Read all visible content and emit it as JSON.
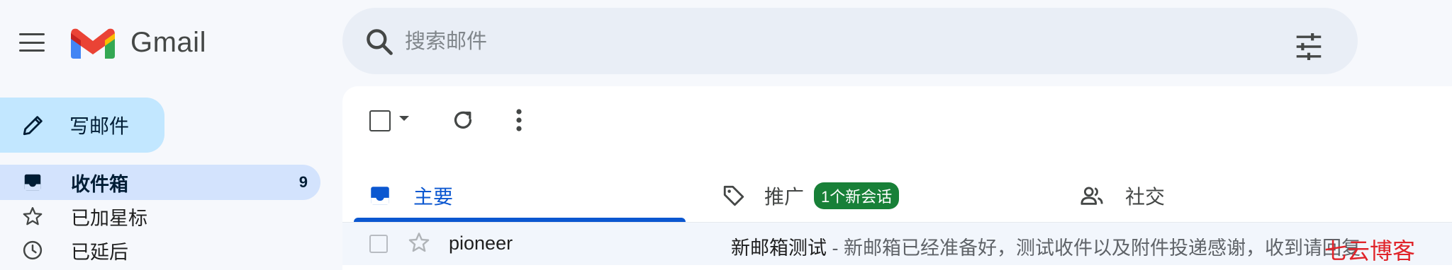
{
  "app": {
    "name": "Gmail"
  },
  "search": {
    "placeholder": "搜索邮件"
  },
  "compose": {
    "label": "写邮件"
  },
  "sidebar": {
    "items": [
      {
        "label": "收件箱",
        "count": "9"
      },
      {
        "label": "已加星标"
      },
      {
        "label": "已延后"
      }
    ]
  },
  "tabs": [
    {
      "label": "主要"
    },
    {
      "label": "推广",
      "badge": "1个新会话"
    },
    {
      "label": "社交"
    }
  ],
  "emails": [
    {
      "sender": "pioneer",
      "subject": "新邮箱测试",
      "snippet": " - 新邮箱已经准备好，测试收件以及附件投递感谢，收到请回复"
    }
  ],
  "watermark": "七云博客",
  "colors": {
    "accent": "#0b57d0",
    "compose_bg": "#c2e7ff",
    "badge": "#188038",
    "active_nav": "#d3e3fd"
  }
}
